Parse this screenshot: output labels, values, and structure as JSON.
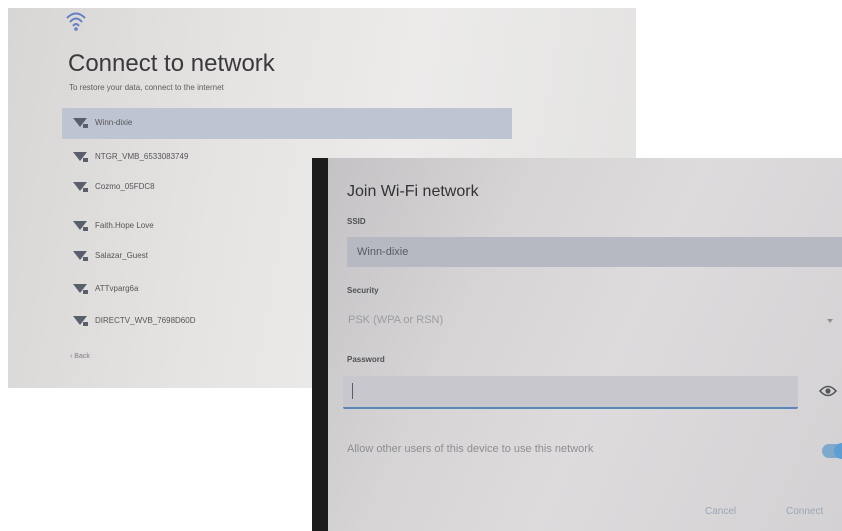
{
  "network_screen": {
    "title": "Connect to network",
    "subtitle": "To restore your data, connect to the internet",
    "networks": [
      {
        "name": "Winn-dixie",
        "selected": true
      },
      {
        "name": "NTGR_VMB_6533083749",
        "selected": false
      },
      {
        "name": "Cozmo_05FDC8",
        "selected": false
      },
      {
        "name": "Faith.Hope Love",
        "selected": false
      },
      {
        "name": "Salazar_Guest",
        "selected": false
      },
      {
        "name": "ATTvparg6a",
        "selected": false
      },
      {
        "name": "DIRECTV_WVB_7698D60D",
        "selected": false
      }
    ],
    "back_label": "Back",
    "icons": {
      "status": "wifi-icon",
      "network": "wifi-lock-icon",
      "back": "chevron-left-icon"
    }
  },
  "join_dialog": {
    "title": "Join Wi-Fi network",
    "ssid_label": "SSID",
    "ssid_value": "Winn-dixie",
    "security_label": "Security",
    "security_value": "PSK (WPA or RSN)",
    "password_label": "Password",
    "password_value": "",
    "allow_label": "Allow other users of this device to use this network",
    "allow_enabled": true,
    "cancel_label": "Cancel",
    "connect_label": "Connect",
    "icons": {
      "dropdown": "caret-down-icon",
      "show_password": "eye-icon"
    }
  },
  "colors": {
    "selected_row": "#bfc4d3",
    "ssid_field": "#b6b9c2",
    "accent": "#5d9fd3",
    "underline": "#5b86b8"
  }
}
